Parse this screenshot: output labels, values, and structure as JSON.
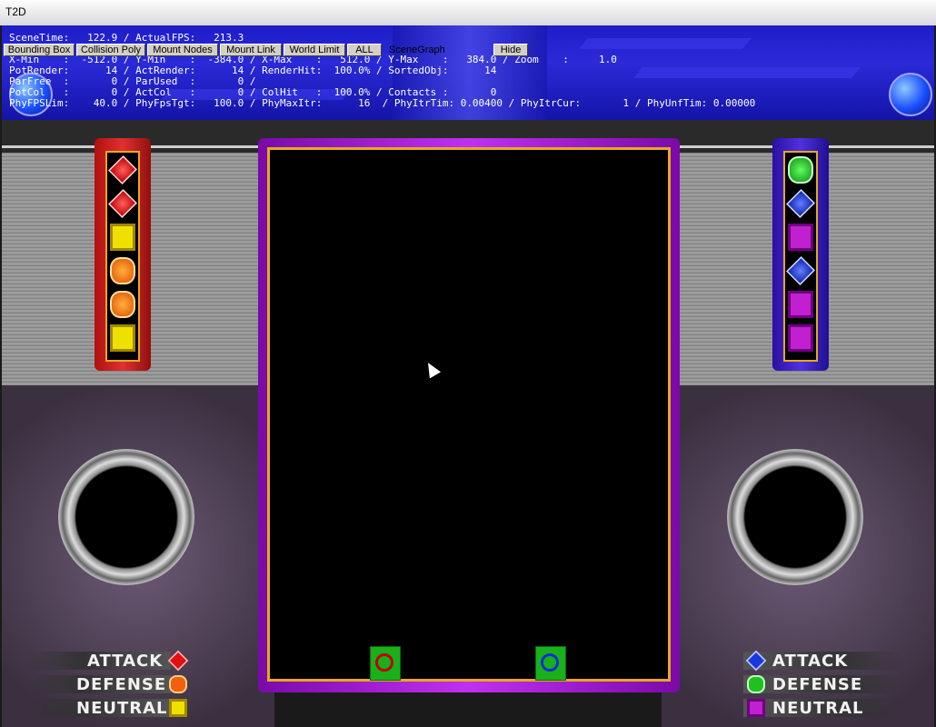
{
  "window": {
    "title": "T2D"
  },
  "debug": {
    "line1": "SceneTime:   122.9 / ActualFPS:   213.3",
    "line2": "X-Min    :  -512.0 / Y-Min    :  -384.0 / X-Max    :   512.0 / Y-Max    :   384.0 / Zoom    :     1.0",
    "line3": "PotRender:      14 / ActRender:      14 / RenderHit:  100.0% / SortedObj:      14",
    "line4": "ParFree  :       0 / ParUsed  :       0 /",
    "line5": "PotCol   :       0 / ActCol   :       0 / ColHit   :  100.0% / Contacts :       0",
    "line6": "PhyFPSLim:    40.0 / PhyFpsTgt:   100.0 / PhyMaxItr:      16  / PhyItrTim: 0.00400 / PhyItrCur:       1 / PhyUnfTim: 0.00000"
  },
  "toolbar": {
    "bounding_box": "Bounding Box",
    "collision_poly": "Collision Poly",
    "mount_nodes": "Mount Nodes",
    "mount_link": "Mount Link",
    "world_limit": "World Limit",
    "all": "ALL",
    "scenegraph": "SceneGraph",
    "hide": "Hide"
  },
  "left_panel": {
    "color": "#c01818",
    "gems": [
      "diamond-red",
      "diamond-red",
      "square-yellow",
      "hex-orange",
      "hex-orange",
      "square-yellow"
    ]
  },
  "right_panel": {
    "color": "#3a20c0",
    "gems": [
      "hex-green",
      "diamond-blue",
      "square-purple",
      "diamond-blue",
      "square-purple",
      "square-purple"
    ]
  },
  "legend_left": {
    "attack": "ATTACK",
    "defense": "DEFENSE",
    "neutral": "NEUTRAL"
  },
  "legend_right": {
    "attack": "ATTACK",
    "defense": "DEFENSE",
    "neutral": "NEUTRAL"
  },
  "colors": {
    "field_border": "#e8a820",
    "field_frame": "#b020e0",
    "header_blue": "#2020d0"
  }
}
